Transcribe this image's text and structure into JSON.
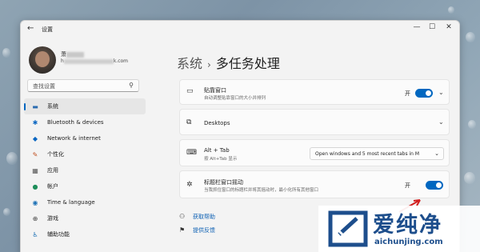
{
  "window": {
    "app_title": "设置",
    "controls": [
      "—",
      "☐",
      "✕"
    ]
  },
  "profile": {
    "name_visible": "萧",
    "email_visible_start": "h",
    "email_visible_end": "k.com"
  },
  "search": {
    "placeholder": "查找设置"
  },
  "sidebar": {
    "items": [
      {
        "label": "系统",
        "icon": "monitor-icon",
        "active": true
      },
      {
        "label": "Bluetooth & devices",
        "icon": "bluetooth-icon"
      },
      {
        "label": "Network & internet",
        "icon": "wifi-icon"
      },
      {
        "label": "个性化",
        "icon": "brush-icon"
      },
      {
        "label": "应用",
        "icon": "apps-icon"
      },
      {
        "label": "帐户",
        "icon": "account-icon"
      },
      {
        "label": "Time & language",
        "icon": "globe-icon"
      },
      {
        "label": "游戏",
        "icon": "gamepad-icon"
      },
      {
        "label": "辅助功能",
        "icon": "accessibility-icon"
      }
    ]
  },
  "breadcrumb": {
    "parent": "系统",
    "separator": "›",
    "current": "多任务处理"
  },
  "cards": {
    "snap": {
      "title": "贴靠窗口",
      "subtitle": "自动调整贴靠窗口的大小并排列",
      "toggle_label": "开",
      "on": true
    },
    "desktops": {
      "title": "Desktops"
    },
    "alttab": {
      "title": "Alt + Tab",
      "subtitle": "按 Alt+Tab 显示",
      "dropdown_value": "Open windows and 5 most recent tabs in M"
    },
    "shake": {
      "title": "标题栏窗口摇动",
      "subtitle": "当我抓住窗口的标题栏并将其摇动时，最小化所有其他窗口",
      "toggle_label": "开",
      "on": true
    }
  },
  "links": {
    "help": "获取帮助",
    "feedback": "提供反馈"
  },
  "watermark": {
    "brand_cn": "爱纯净",
    "url": "aichunjing.com"
  },
  "colors": {
    "accent": "#0067c0",
    "brand": "#1d4e8c",
    "annotation_arrow": "#d22020"
  }
}
